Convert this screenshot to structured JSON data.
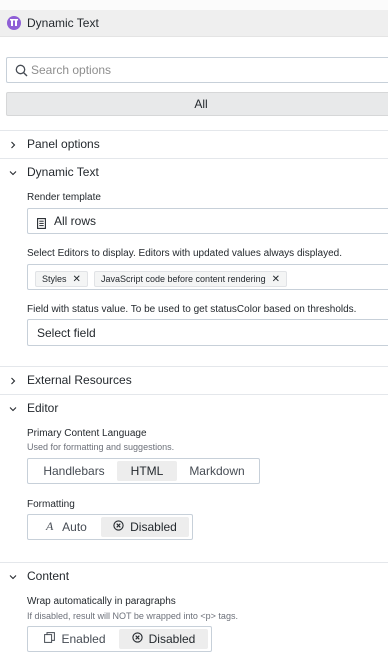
{
  "header": {
    "title": "Dynamic Text"
  },
  "search": {
    "placeholder": "Search options",
    "value": ""
  },
  "filter": {
    "all_label": "All"
  },
  "sections": {
    "panel_options": "Panel options",
    "dynamic_text": "Dynamic Text",
    "external_resources": "External Resources",
    "editor": "Editor",
    "content": "Content"
  },
  "render_template": {
    "label": "Render template",
    "value": "All rows"
  },
  "editors": {
    "label": "Select Editors to display. Editors with updated values always displayed.",
    "tags": [
      "Styles",
      "JavaScript code before content rendering"
    ]
  },
  "status_field": {
    "label": "Field with status value. To be used to get statusColor based on thresholds.",
    "placeholder": "Select field"
  },
  "primary_language": {
    "label": "Primary Content Language",
    "description": "Used for formatting and suggestions.",
    "options": [
      "Handlebars",
      "HTML",
      "Markdown"
    ],
    "selected": "HTML"
  },
  "formatting": {
    "label": "Formatting",
    "options": [
      "Auto",
      "Disabled"
    ],
    "selected": "Disabled"
  },
  "wrap": {
    "label": "Wrap automatically in paragraphs",
    "description": "If disabled, result will NOT be wrapped into <p> tags.",
    "options": [
      "Enabled",
      "Disabled"
    ],
    "selected": "Disabled"
  },
  "icons": {
    "plugin": "dynamic-text-plugin-icon",
    "search": "search-icon",
    "collapsed": "chevron-right-icon",
    "expanded": "chevron-down-icon",
    "template": "document-icon",
    "remove": "close-icon",
    "auto": "font-italic-icon",
    "disabled": "circle-x-icon",
    "enabled": "paragraph-icon"
  },
  "colors": {
    "accent": "#8f5fd6",
    "border": "#c7d0d9",
    "active_bg": "#ededed"
  }
}
